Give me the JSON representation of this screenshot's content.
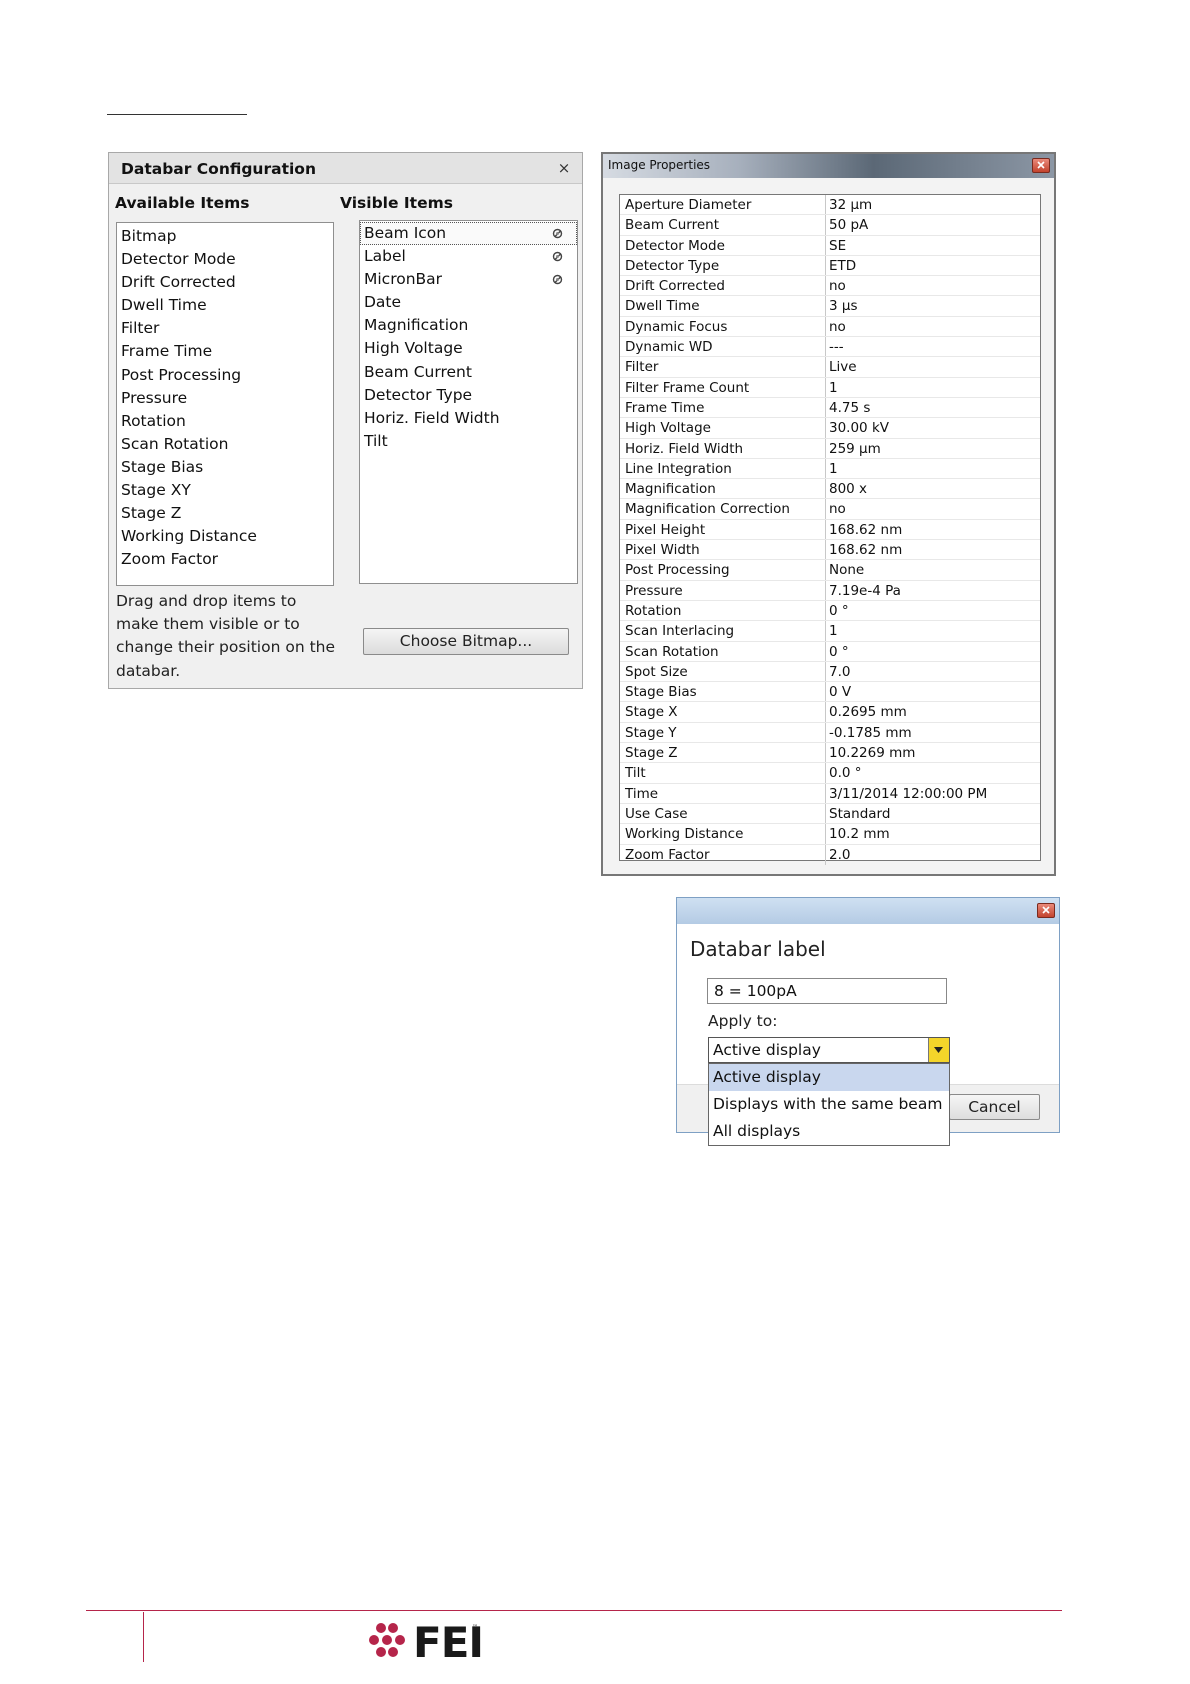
{
  "databar_config": {
    "title": "Databar Configuration",
    "close_glyph": "×",
    "available_header": "Available Items",
    "visible_header": "Visible Items",
    "available_items": [
      "Bitmap",
      "Detector Mode",
      "Drift Corrected",
      "Dwell Time",
      "Filter",
      "Frame Time",
      "Post Processing",
      "Pressure",
      "Rotation",
      "Scan Rotation",
      "Stage Bias",
      "Stage XY",
      "Stage Z",
      "Working Distance",
      "Zoom Factor"
    ],
    "visible_items": [
      "Beam Icon",
      "Label",
      "MicronBar",
      "Date",
      "Magnification",
      "High Voltage",
      "Beam Current",
      "Detector Type",
      "Horiz. Field Width",
      "Tilt"
    ],
    "locked_icon": "lock-icon",
    "help_text": "Drag and drop items to make them visible or to change their position on the databar.",
    "choose_bitmap_label": "Choose Bitmap..."
  },
  "image_properties": {
    "title": "Image Properties",
    "rows": [
      [
        "Aperture Diameter",
        "32 μm"
      ],
      [
        "Beam Current",
        "50 pA"
      ],
      [
        "Detector Mode",
        "SE"
      ],
      [
        "Detector Type",
        "ETD"
      ],
      [
        "Drift Corrected",
        "no"
      ],
      [
        "Dwell Time",
        "3 μs"
      ],
      [
        "Dynamic Focus",
        "no"
      ],
      [
        "Dynamic WD",
        "---"
      ],
      [
        "Filter",
        "Live"
      ],
      [
        "Filter Frame Count",
        "1"
      ],
      [
        "Frame Time",
        "4.75 s"
      ],
      [
        "High Voltage",
        "30.00 kV"
      ],
      [
        "Horiz. Field Width",
        "259 μm"
      ],
      [
        "Line Integration",
        "1"
      ],
      [
        "Magnification",
        "800 x"
      ],
      [
        "Magnification Correction",
        "no"
      ],
      [
        "Pixel Height",
        "168.62 nm"
      ],
      [
        "Pixel Width",
        "168.62 nm"
      ],
      [
        "Post Processing",
        "None"
      ],
      [
        "Pressure",
        "7.19e-4 Pa"
      ],
      [
        "Rotation",
        "0 °"
      ],
      [
        "Scan Interlacing",
        "1"
      ],
      [
        "Scan Rotation",
        "0 °"
      ],
      [
        "Spot Size",
        "7.0"
      ],
      [
        "Stage Bias",
        "0 V"
      ],
      [
        "Stage X",
        "0.2695 mm"
      ],
      [
        "Stage Y",
        "-0.1785 mm"
      ],
      [
        "Stage Z",
        "10.2269 mm"
      ],
      [
        "Tilt",
        "0.0 °"
      ],
      [
        "Time",
        "3/11/2014 12:00:00 PM"
      ],
      [
        "Use Case",
        "Standard"
      ],
      [
        "Working Distance",
        "10.2 mm"
      ],
      [
        "Zoom Factor",
        "2.0"
      ]
    ]
  },
  "databar_label": {
    "heading": "Databar label",
    "label_value": "8 = 100pA",
    "apply_to_label": "Apply to:",
    "selected": "Active display",
    "options": [
      "Active display",
      "Displays with the same beam",
      "All displays"
    ],
    "cancel_label": "Cancel"
  },
  "footer": {
    "logo_text": "FEI",
    "trademark": "™",
    "brand_color": "#b5254a"
  }
}
